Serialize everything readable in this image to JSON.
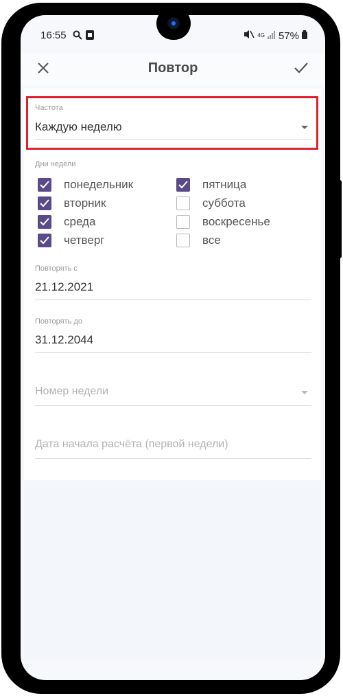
{
  "status_bar": {
    "time": "16:55",
    "network": "4G",
    "battery": "57%"
  },
  "appbar": {
    "title": "Повтор",
    "close_icon": "close-icon",
    "confirm_icon": "check-icon"
  },
  "frequency": {
    "label": "Частота",
    "value": "Каждую неделю"
  },
  "weekdays": {
    "label": "Дни недели",
    "left": [
      {
        "label": "понедельник",
        "checked": true
      },
      {
        "label": "вторник",
        "checked": true
      },
      {
        "label": "среда",
        "checked": true
      },
      {
        "label": "четверг",
        "checked": true
      }
    ],
    "right": [
      {
        "label": "пятница",
        "checked": true
      },
      {
        "label": "суббота",
        "checked": false
      },
      {
        "label": "воскресенье",
        "checked": false
      },
      {
        "label": "все",
        "checked": false
      }
    ]
  },
  "repeat_from": {
    "label": "Повторять с",
    "value": "21.12.2021"
  },
  "repeat_until": {
    "label": "Повторять до",
    "value": "31.12.2044"
  },
  "week_number": {
    "placeholder": "Номер недели"
  },
  "calc_start_date": {
    "placeholder": "Дата начала расчёта (первой недели)"
  },
  "colors": {
    "accent": "#5a4a8a",
    "highlight": "#e0202c"
  }
}
